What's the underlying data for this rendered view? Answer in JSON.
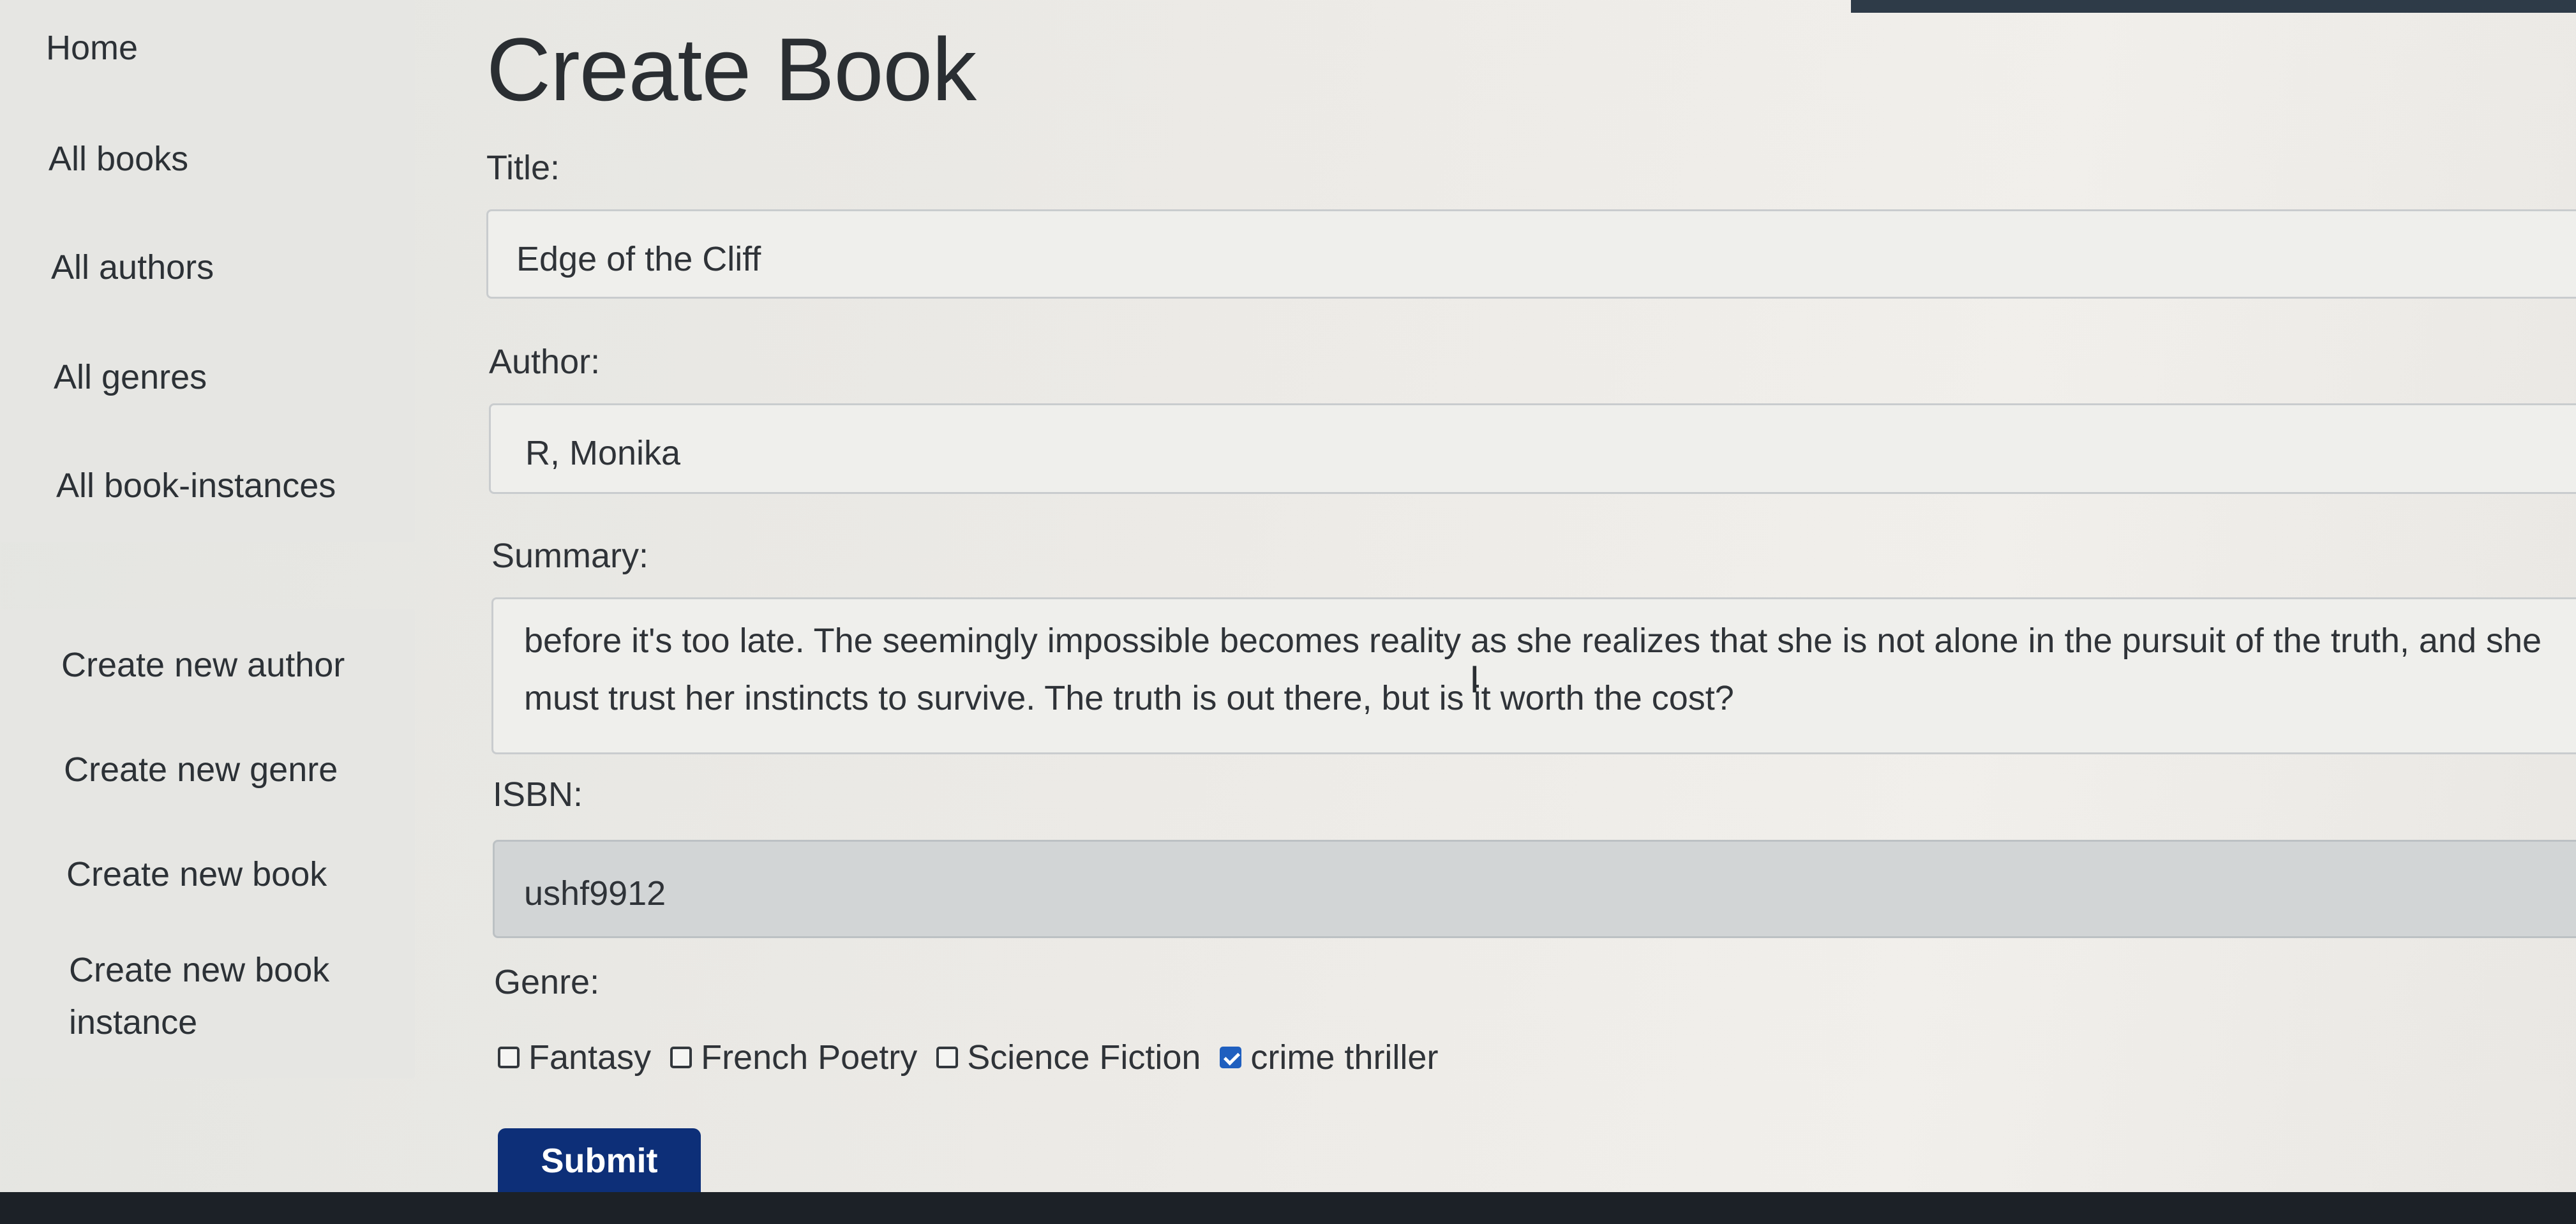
{
  "sidebar": {
    "nav": [
      {
        "label": "Home"
      },
      {
        "label": "All books"
      },
      {
        "label": "All authors"
      },
      {
        "label": "All genres"
      },
      {
        "label": "All book-instances"
      }
    ],
    "create": [
      {
        "label": "Create new author"
      },
      {
        "label": "Create new genre"
      },
      {
        "label": "Create new book"
      },
      {
        "label": "Create new book instance"
      }
    ]
  },
  "form": {
    "title": "Create Book",
    "title_label": "Title:",
    "title_value": "Edge of the Cliff",
    "author_label": "Author:",
    "author_value": "R, Monika",
    "summary_label": "Summary:",
    "summary_value": "before it's too late. The seemingly impossible becomes reality as she realizes that she is not alone in the pursuit of the truth, and she must trust her instincts to survive. The truth is out there, but is it worth the cost?",
    "isbn_label": "ISBN:",
    "isbn_value": "ushf9912",
    "genre_label": "Genre:",
    "genres": [
      {
        "label": "Fantasy",
        "checked": false
      },
      {
        "label": "French Poetry",
        "checked": false
      },
      {
        "label": "Science Fiction",
        "checked": false
      },
      {
        "label": "crime thriller",
        "checked": true
      }
    ],
    "submit_label": "Submit"
  },
  "colors": {
    "submit_button": "#0d2f78",
    "checkbox_checked": "#1f5fbf"
  }
}
